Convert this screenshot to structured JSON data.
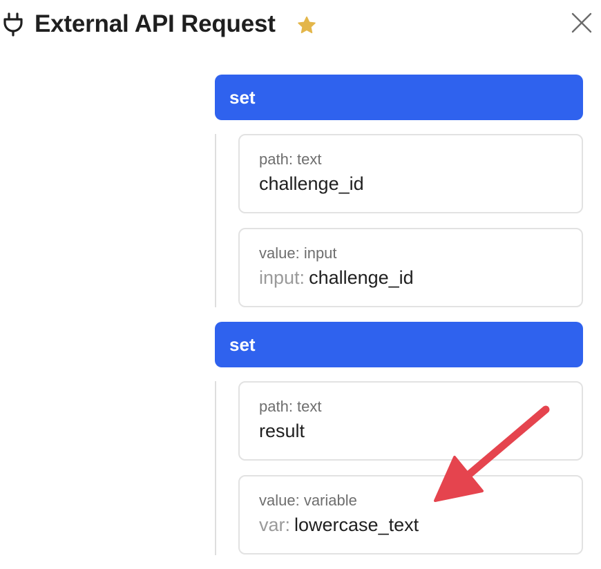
{
  "header": {
    "title": "External API Request",
    "icon": "plug-icon",
    "favorite_icon": "star-icon",
    "close_icon": "close-icon",
    "star_color": "#e3b64a"
  },
  "blocks": [
    {
      "header": "set",
      "path_label": "path: text",
      "path_value": "challenge_id",
      "value_label": "value: input",
      "value_prefix": "input:",
      "value_value": "challenge_id"
    },
    {
      "header": "set",
      "path_label": "path: text",
      "path_value": "result",
      "value_label": "value: variable",
      "value_prefix": "var:",
      "value_value": "lowercase_text"
    }
  ],
  "colors": {
    "accent": "#2f62ee",
    "annotation_arrow": "#e5444e"
  }
}
